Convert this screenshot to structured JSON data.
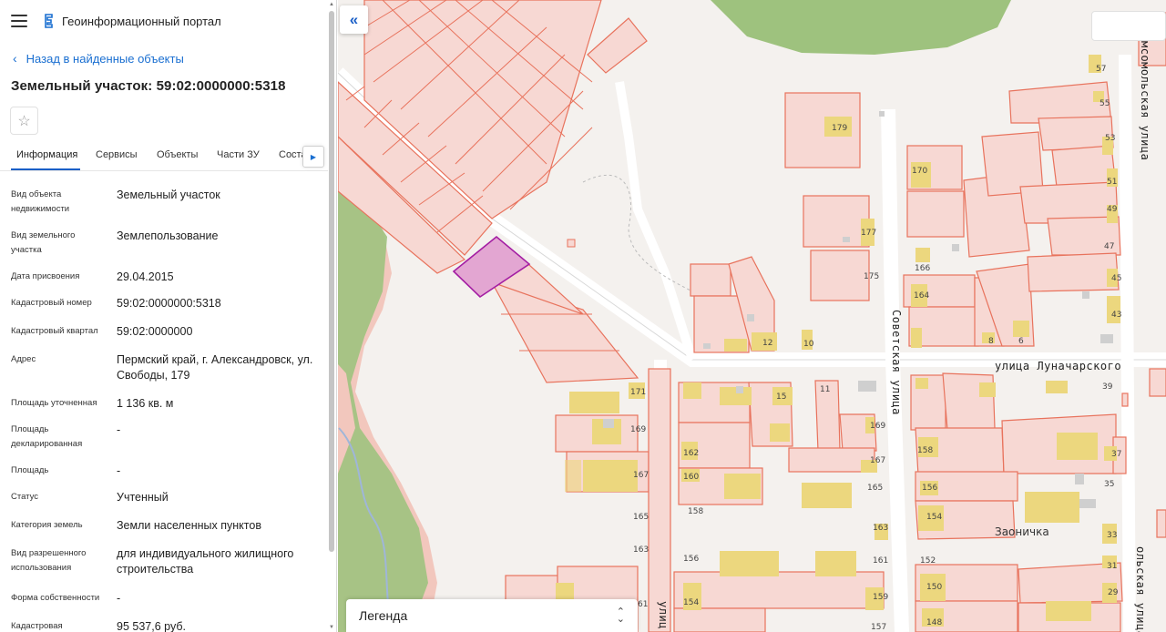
{
  "header": {
    "portal_title": "Геоинформационный портал"
  },
  "nav": {
    "back_label": "Назад в найденные объекты"
  },
  "object": {
    "title": "Земельный участок: 59:02:0000000:5318"
  },
  "tabs": [
    {
      "label": "Информация",
      "active": true
    },
    {
      "label": "Сервисы"
    },
    {
      "label": "Объекты"
    },
    {
      "label": "Части ЗУ"
    },
    {
      "label": "Соста"
    }
  ],
  "details": [
    {
      "label": "Вид объекта недвижимости",
      "value": "Земельный участок"
    },
    {
      "label": "Вид земельного участка",
      "value": "Землепользование"
    },
    {
      "label": "Дата присвоения",
      "value": "29.04.2015"
    },
    {
      "label": "Кадастровый номер",
      "value": "59:02:0000000:5318"
    },
    {
      "label": "Кадастровый квартал",
      "value": "59:02:0000000"
    },
    {
      "label": "Адрес",
      "value": "Пермский край, г. Александровск, ул. Свободы, 179"
    },
    {
      "label": "Площадь уточненная",
      "value": "1 136 кв. м"
    },
    {
      "label": "Площадь декларированная",
      "value": "-"
    },
    {
      "label": "Площадь",
      "value": "-"
    },
    {
      "label": "Статус",
      "value": "Учтенный"
    },
    {
      "label": "Категория земель",
      "value": "Земли населенных пунктов"
    },
    {
      "label": "Вид разрешенного использования",
      "value": "для индивидуального жилищного строительства"
    },
    {
      "label": "Форма собственности",
      "value": "-"
    },
    {
      "label": "Кадастровая",
      "value": "95 537,6 руб."
    }
  ],
  "map": {
    "collapse_icon": "«",
    "legend_label": "Легенда",
    "streets": {
      "lunacharskogo": "улица Луначарского",
      "sovetskaya": "Советская улица",
      "komsomolskaya": "мсомольская улица",
      "komsomolskaya_bottom": "ольская улица",
      "bottom_left": "улиц"
    },
    "district": "Заоничка",
    "house_numbers": [
      "57",
      "55",
      "53",
      "51",
      "49",
      "47",
      "45",
      "43",
      "179",
      "170",
      "177",
      "175",
      "166",
      "164",
      "12",
      "10",
      "8",
      "6",
      "39",
      "171",
      "169",
      "15",
      "11",
      "169",
      "162",
      "160",
      "167",
      "165",
      "158",
      "156",
      "154",
      "37",
      "35",
      "33",
      "31",
      "29",
      "167",
      "165",
      "163",
      "161",
      "159",
      "157",
      "163",
      "165",
      "163",
      "161",
      "156",
      "154",
      "152",
      "150",
      "148",
      "158",
      "61"
    ],
    "colors": {
      "parcel_fill": "#f7d8d3",
      "parcel_stroke": "#e8735d",
      "selected_fill": "#e3a6d2",
      "selected_stroke": "#a41ea3",
      "building": "#ecd77e",
      "green": "#9ec27e",
      "road": "#ffffff"
    }
  }
}
